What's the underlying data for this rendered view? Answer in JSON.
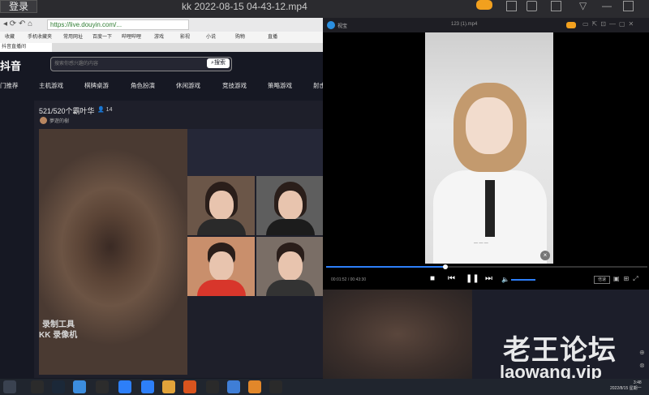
{
  "recorder": {
    "login_label": "登录",
    "file_title": "kk 2022-08-15 04-43-12.mp4"
  },
  "browser": {
    "url": "https://live.douyin.com/...",
    "bookmarks": [
      "收藏",
      "手机收藏夹",
      "常用网址",
      "百度一下",
      "哔哩哔哩",
      "游戏",
      "影视",
      "小说",
      "购物",
      "直播"
    ],
    "tab_label": "抖音直播间"
  },
  "douyin": {
    "logo": "抖音",
    "search_placeholder": "搜索你感兴趣的内容",
    "search_button": "搜索",
    "categories": [
      "门推荐",
      "主机游戏",
      "棋牌桌游",
      "角色扮演",
      "休闲游戏",
      "竞技游戏",
      "策略游戏",
      "射击"
    ]
  },
  "live_room": {
    "title": "521/520个霸叶华",
    "viewer_count": "14",
    "host_name": "夢遊的樹",
    "watermark_line1": "录制工具",
    "watermark_line2": "KK 录像机"
  },
  "player": {
    "app_name": "视宝",
    "file_name": "123 (1).mp4",
    "time_current": "00:01:52 / 00:43:30",
    "speed_label": "倍速",
    "progress": 0.37
  },
  "overlay": {
    "forum_name": "老王论坛",
    "forum_url": "laowang.vip"
  },
  "taskbar": {
    "time": "3:48",
    "date": "2022/8/15 星期一"
  },
  "colors": {
    "accent": "#2d7ff9",
    "douyin_bg": "#161823"
  }
}
